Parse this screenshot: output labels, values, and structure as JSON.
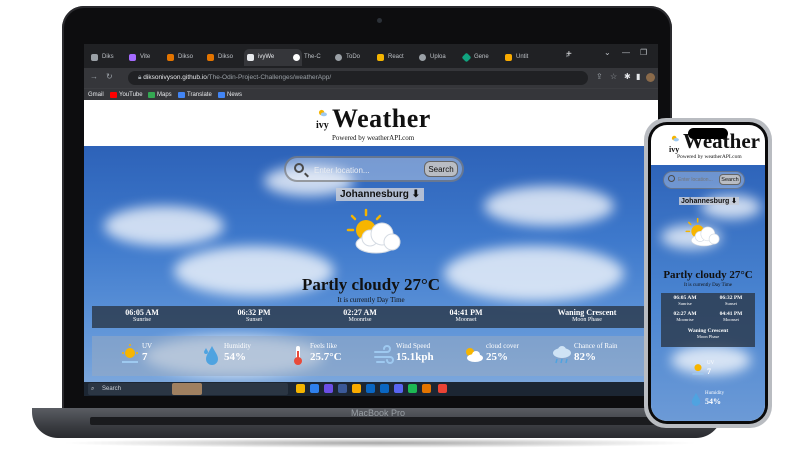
{
  "browser": {
    "tabs": [
      {
        "label": "Diks",
        "color": "#9aa0a6"
      },
      {
        "label": "Vite",
        "color": "#a56bff"
      },
      {
        "label": "Dikso",
        "color": "#e37400"
      },
      {
        "label": "Dikso",
        "color": "#e37400"
      },
      {
        "label": "ivyWe",
        "color": "#e8eaed",
        "active": true
      },
      {
        "label": "The-C",
        "color": "#ffffff"
      },
      {
        "label": "ToDo",
        "color": "#9aa0a6"
      },
      {
        "label": "React",
        "color": "#f4b400"
      },
      {
        "label": "Uploa",
        "color": "#9aa0a6"
      },
      {
        "label": "Gene",
        "color": "#10a37f"
      },
      {
        "label": "Untit",
        "color": "#f9ab00"
      }
    ],
    "url_domain": "diksonivyson.github.io",
    "url_path": "/The-Odin-Project-Challenges/weatherApp/",
    "bookmarks": [
      {
        "label": "Gmail",
        "color": "#ea4335"
      },
      {
        "label": "YouTube",
        "color": "#ff0000"
      },
      {
        "label": "Maps",
        "color": "#34a853"
      },
      {
        "label": "Translate",
        "color": "#4285f4"
      },
      {
        "label": "News",
        "color": "#4285f4"
      }
    ]
  },
  "app": {
    "logo_prefix": "ivy",
    "title": "Weather",
    "subtitle": "Powered by weatherAPI.com",
    "search_placeholder": "Enter location...",
    "search_button": "Search",
    "city": "Johannesburg ⬇",
    "condition": "Partly cloudy 27°C",
    "day_note": "It is currently Day Time",
    "info": [
      {
        "value": "06:05 AM",
        "label": "Sunrise"
      },
      {
        "value": "06:32 PM",
        "label": "Sunset"
      },
      {
        "value": "02:27 AM",
        "label": "Moonrise"
      },
      {
        "value": "04:41 PM",
        "label": "Moonset"
      },
      {
        "value": "Waning Crescent",
        "label": "Moon Phase"
      }
    ],
    "stats": [
      {
        "label": "UV",
        "value": "7",
        "icon": "uv-sun-icon"
      },
      {
        "label": "Humidity",
        "value": "54%",
        "icon": "humidity-drops-icon"
      },
      {
        "label": "Feels like",
        "value": "25.7°C",
        "icon": "thermometer-icon"
      },
      {
        "label": "Wind Speed",
        "value": "15.1kph",
        "icon": "wind-icon"
      },
      {
        "label": "cloud cover",
        "value": "25%",
        "icon": "cloud-cover-icon"
      },
      {
        "label": "Chance of Rain",
        "value": "82%",
        "icon": "rain-cloud-icon"
      }
    ]
  },
  "taskbar": {
    "search_label": "Search"
  },
  "device_label": "MacBook Pro",
  "phone": {
    "title": "Weather",
    "logo_prefix": "ivy",
    "subtitle": "Powered by weatherAPI.com",
    "search_placeholder": "Enter location...",
    "search_button": "Search",
    "city": "Johannesburg ⬇",
    "condition": "Partly cloudy 27°C",
    "day_note": "It is currently Day Time",
    "info": [
      {
        "value": "06:05 AM",
        "label": "Sunrise"
      },
      {
        "value": "06:32 PM",
        "label": "Sunset"
      },
      {
        "value": "02:27 AM",
        "label": "Moonrise"
      },
      {
        "value": "04:41 PM",
        "label": "Moonset"
      }
    ],
    "moon_value": "Waning Crescent",
    "moon_label": "Moon Phase",
    "stats": [
      {
        "label": "UV",
        "value": "7"
      },
      {
        "label": "Humidity",
        "value": "54%"
      }
    ]
  }
}
